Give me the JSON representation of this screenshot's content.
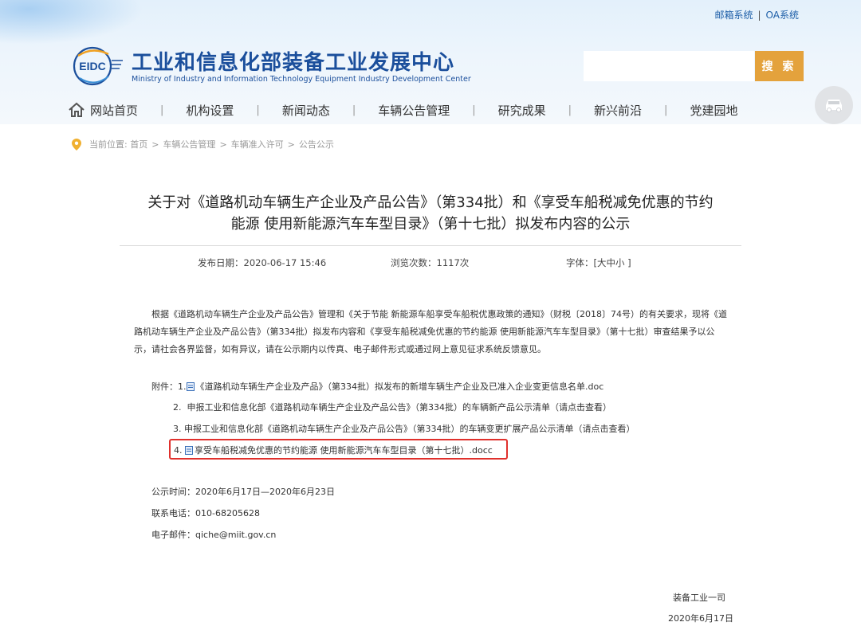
{
  "header": {
    "top_links": [
      "邮箱系统",
      "OA系统"
    ],
    "top_link_sep": "|",
    "logo_text": "EIDC",
    "site_title": "工业和信息化部装备工业发展中心",
    "site_subtitle": "Ministry of Industry and Information Technology Equipment Industry Development Center",
    "search_placeholder": "",
    "search_button": "搜 索"
  },
  "nav": {
    "items": [
      "网站首页",
      "机构设置",
      "新闻动态",
      "车辆公告管理",
      "研究成果",
      "新兴前沿",
      "党建园地"
    ],
    "sep": "|"
  },
  "breadcrumb": {
    "label": "当前位置:",
    "items": [
      "首页",
      "车辆公告管理",
      "车辆准入许可",
      "公告公示"
    ],
    "arrow": ">"
  },
  "article": {
    "title_line1": "关于对《道路机动车辆生产企业及产品公告》（第334批）和《享受车船税减免优惠的节约",
    "title_line2": "能源 使用新能源汽车车型目录》（第十七批）拟发布内容的公示",
    "publish_label": "发布日期：",
    "publish_date": "2020-06-17 15:46",
    "views_label": "浏览次数：",
    "views": "1117次",
    "font_label": "字体：[",
    "font_large": "大",
    "font_medium": "中",
    "font_small": "小",
    "font_end": " ]",
    "paragraph": "根据《道路机动车辆生产企业及产品公告》管理和《关于节能 新能源车船享受车船税优惠政策的通知》（财税〔2018〕74号）的有关要求，现将《道路机动车辆生产企业及产品公告》（第334批）拟发布内容和《享受车船税减免优惠的节约能源 使用新能源汽车车型目录》（第十七批）审查结果予以公示，请社会各界监督，如有异议，请在公示期内以传真、电子邮件形式或通过网上意见征求系统反馈意见。",
    "attachments_label": "附件：",
    "attachments": [
      {
        "num": "1.",
        "text": "《道路机动车辆生产企业及产品》（第334批）拟发布的新增车辆生产企业及已准入企业变更信息名单.doc"
      },
      {
        "num": "2.",
        "text": "申报工业和信息化部《道路机动车辆生产企业及产品公告》（第334批）的车辆新产品公示清单（请点击查看）"
      },
      {
        "num": "3.",
        "text": "申报工业和信息化部《道路机动车辆生产企业及产品公告》（第334批）的车辆变更扩展产品公示清单（请点击查看）"
      },
      {
        "num": "4.",
        "text": "享受车船税减免优惠的节约能源 使用新能源汽车车型目录（第十七批）.docc"
      }
    ],
    "period": "公示时间：2020年6月17日—2020年6月23日",
    "phone": "联系电话：010-68205628",
    "email": "电子邮件：qiche@miit.gov.cn",
    "signer": "装备工业一司",
    "sign_date": "2020年6月17日"
  },
  "colors": {
    "brand_blue": "#1b4f9c",
    "search_button": "#e4a23c",
    "highlight_border": "#e0302c"
  },
  "icons": [
    "home-icon",
    "location-pin-icon",
    "car-icon",
    "document-icon",
    "globe-network-icon"
  ]
}
